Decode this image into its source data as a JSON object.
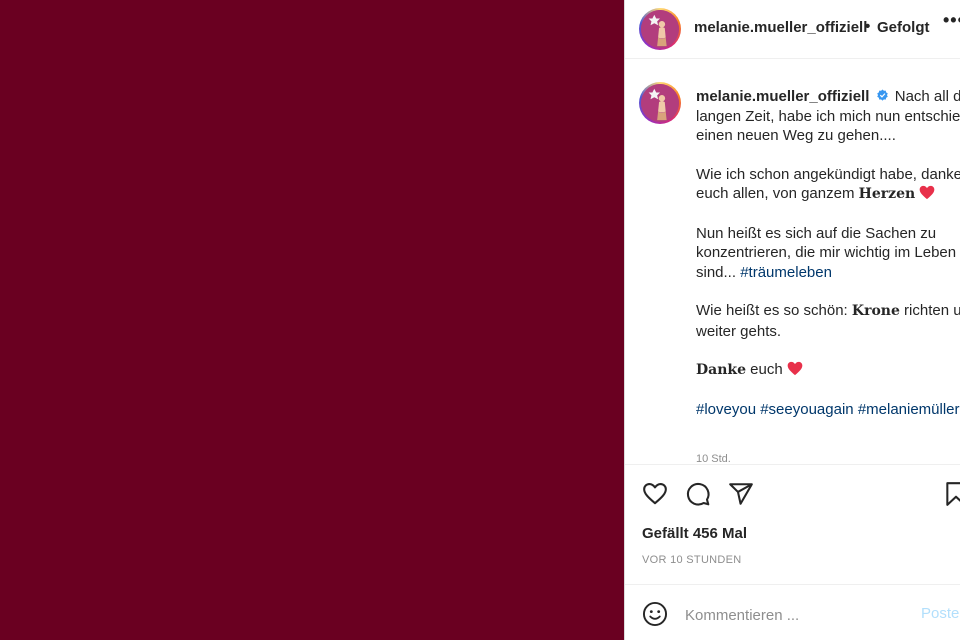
{
  "colors": {
    "media_bg": "#6a0021",
    "hashtag": "#00376b",
    "verified": "#3897f0",
    "muted": "#8e8e8e",
    "post_button": "#b2dffc"
  },
  "header": {
    "username": "melanie.mueller_offiziell",
    "separator": "•",
    "follow_status": "Gefolgt",
    "more_icon": "more-horizontal-icon"
  },
  "caption": {
    "username": "melanie.mueller_offiziell",
    "verified_icon": "verified-badge-icon",
    "p1": "Nach all der langen Zeit, habe ich mich nun entschieden einen neuen Weg zu gehen....",
    "p2_text": "Wie ich schon angekündigt habe, danke ich euch allen, von ganzem",
    "p2_bold": "Herzen",
    "p3_text": "Nun heißt es sich auf die Sachen zu konzentrieren, die mir wichtig im Leben sind...",
    "p3_tag": "#träumeleben",
    "p4_text": "Wie heißt es so schön:",
    "p4_bold": "Krone",
    "p4_rest": "richten und weiter gehts.",
    "p5_bold": "Danke",
    "p5_text": "euch",
    "tags": [
      "#loveyou",
      "#seeyouagain",
      "#melaniemüller"
    ],
    "time": "10 Std."
  },
  "actions": {
    "icons": [
      "heart-icon",
      "comment-icon",
      "share-icon",
      "bookmark-icon"
    ],
    "likes": "Gefällt 456 Mal",
    "timestamp": "VOR 10 STUNDEN"
  },
  "comment": {
    "placeholder": "Kommentieren ...",
    "post_label": "Posten",
    "emoji_icon": "emoji-icon"
  }
}
